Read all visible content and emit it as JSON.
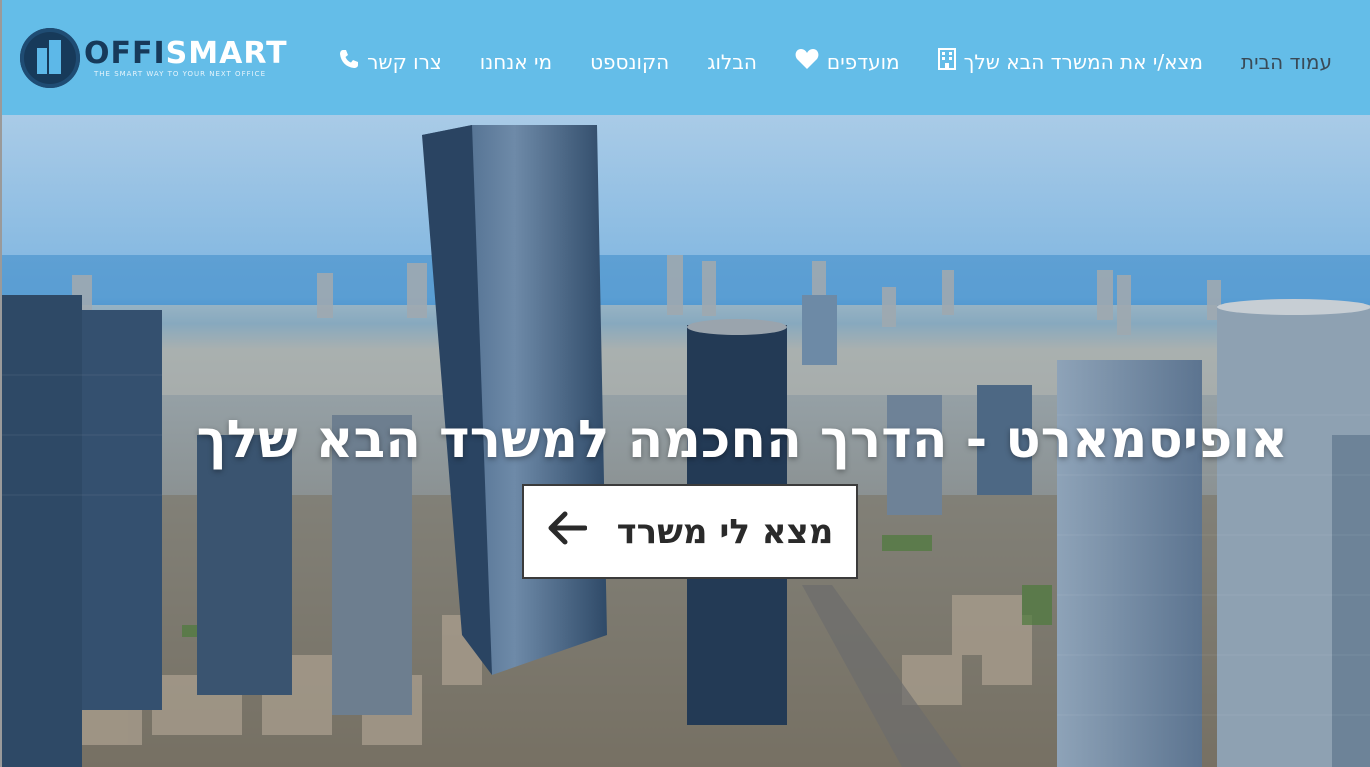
{
  "header": {
    "logo": {
      "word_part1": "OFFI",
      "word_part2": "SMART",
      "tagline": "THE SMART WAY TO YOUR NEXT OFFICE"
    },
    "nav": [
      {
        "label": "עמוד הבית",
        "icon": ""
      },
      {
        "label": "מצא/י את המשרד הבא שלך",
        "icon": "building-icon"
      },
      {
        "label": "מועדפים",
        "icon": "heart-icon"
      },
      {
        "label": "הבלוג",
        "icon": ""
      },
      {
        "label": "הקונספט",
        "icon": ""
      },
      {
        "label": "מי אנחנו",
        "icon": ""
      },
      {
        "label": "צרו קשר",
        "icon": "phone-icon"
      }
    ]
  },
  "hero": {
    "title": "אופיסמארט - הדרך החכמה למשרד הבא שלך",
    "cta_label": "מצא לי משרד",
    "cta_icon": "arrow-left-icon",
    "background": "city-skyline-image"
  },
  "colors": {
    "header_bg": "#64bde8",
    "brand_dark": "#173a5a",
    "home_text": "#3a4a56"
  }
}
